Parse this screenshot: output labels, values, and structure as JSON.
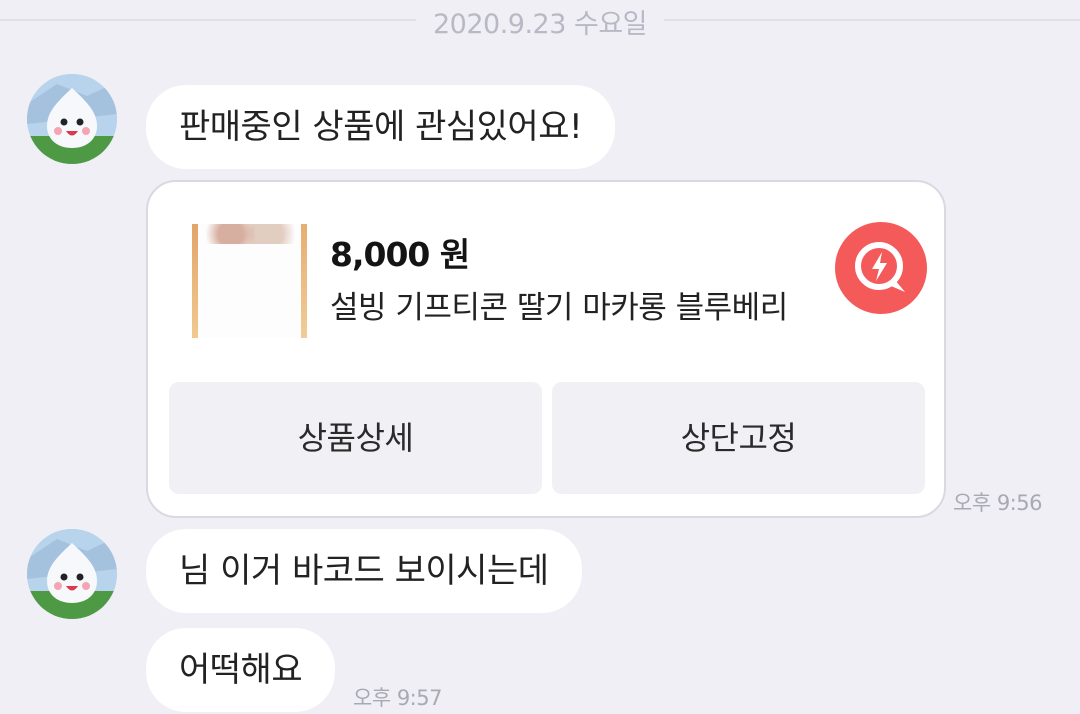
{
  "date_divider": "2020.9.23 수요일",
  "messages": [
    {
      "text": "판매중인 상품에 관심있어요!"
    },
    {
      "text": "님 이거 바코드 보이시는데"
    },
    {
      "text": "어떡해요"
    }
  ],
  "product_card": {
    "price": "8,000 원",
    "name": "설빙 기프티콘 딸기 마카롱 블루베리",
    "detail_button": "상품상세",
    "pin_button": "상단고정",
    "badge_icon": "lightning-bolt-icon",
    "badge_color": "#f45a5a"
  },
  "times": {
    "first": "오후 9:56",
    "second": "오후 9:57"
  }
}
